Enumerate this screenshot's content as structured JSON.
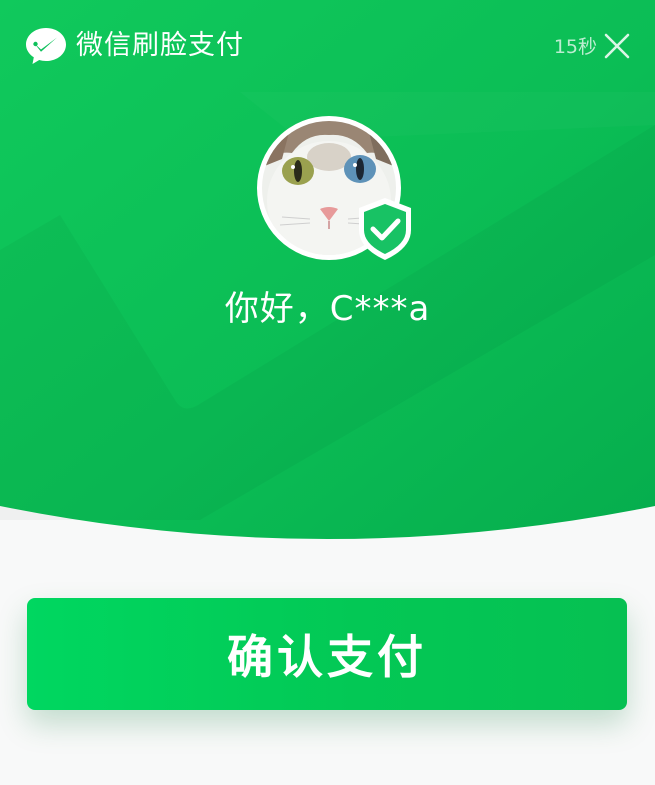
{
  "header": {
    "logo_icon": "wechat-pay-logo-icon",
    "title": "微信刷脸支付",
    "countdown": "15秒",
    "close_icon": "close-icon"
  },
  "profile": {
    "avatar_icon": "cat-avatar",
    "badge_icon": "shield-check-icon",
    "greeting": "你好，C***a"
  },
  "actions": {
    "confirm_label": "确认支付"
  },
  "colors": {
    "brand_green": "#09bb57",
    "hero_green_light": "#0fca5c",
    "hero_green_dark": "#07b050",
    "button_green": "#02d35e",
    "background": "#f8f9f9",
    "text_white": "#ffffff"
  }
}
